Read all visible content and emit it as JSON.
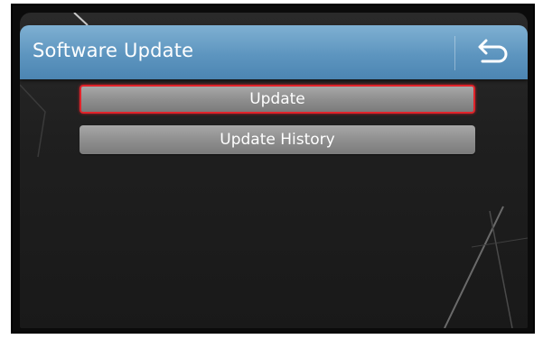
{
  "header": {
    "title": "Software Update",
    "back_icon": "return-arrow-icon"
  },
  "menu": {
    "items": [
      {
        "label": "Update",
        "selected": true
      },
      {
        "label": "Update History",
        "selected": false
      }
    ]
  },
  "colors": {
    "header_blue": "#5d95bf",
    "selection_red": "#e0232a",
    "button_gray": "#8f8f8f"
  }
}
